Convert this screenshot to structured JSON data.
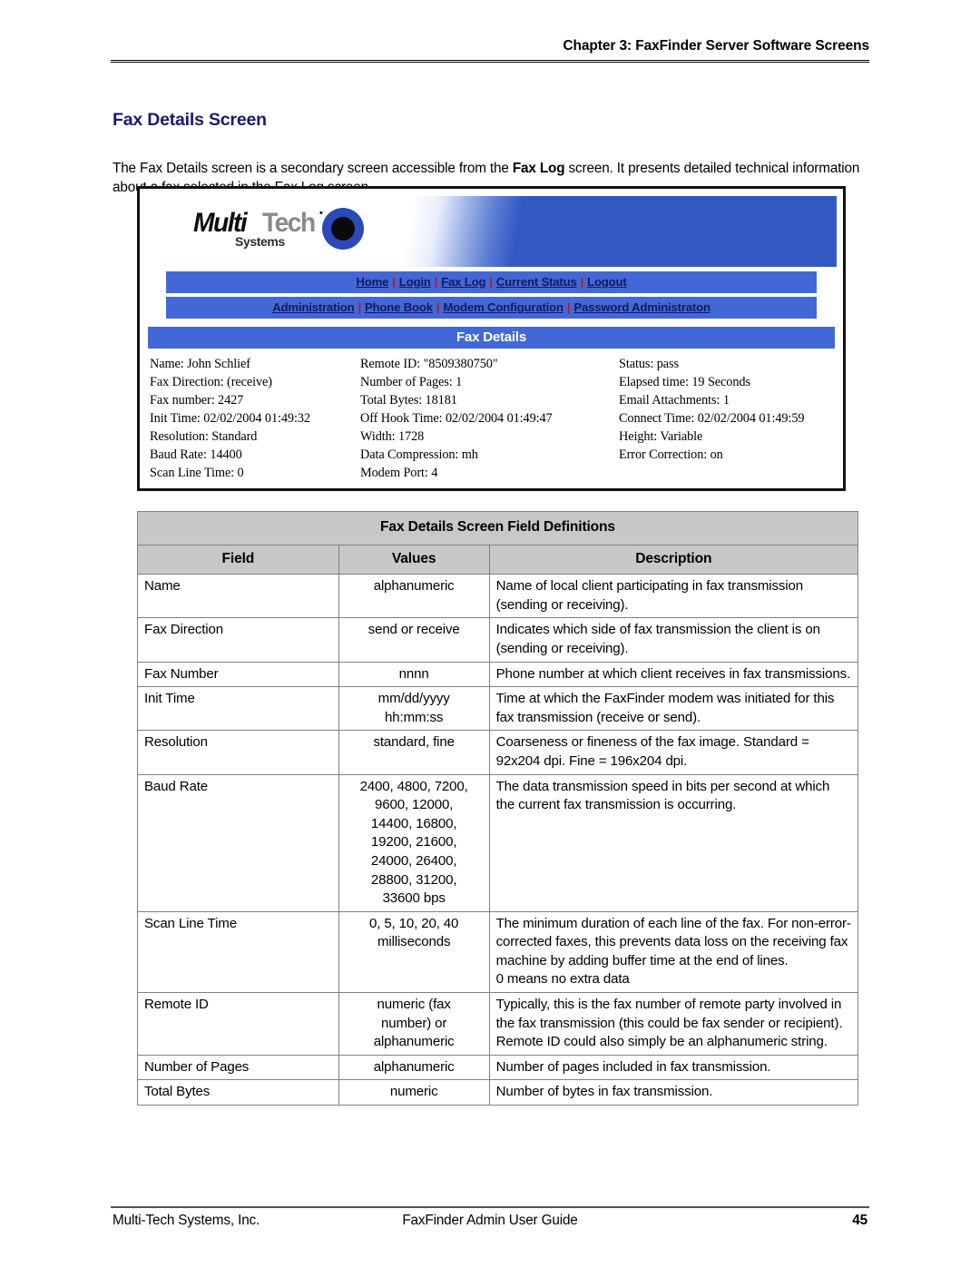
{
  "page": {
    "running_header": "Chapter 3: FaxFinder Server Software Screens",
    "section_title": "Fax Details Screen",
    "intro_part1": "The Fax Details screen is a secondary screen accessible from the ",
    "intro_bold": "Fax Log",
    "intro_part2": " screen.  It presents detailed technical information about a fax selected in the Fax Log screen."
  },
  "screenshot": {
    "logo": {
      "multi": "Multi",
      "tech": "Tech",
      "trademark": "•",
      "systems": "Systems"
    },
    "nav_primary": [
      {
        "label": "Home"
      },
      {
        "label": "Login"
      },
      {
        "label": "Fax Log"
      },
      {
        "label": "Current Status"
      },
      {
        "label": "Logout"
      }
    ],
    "nav_secondary": [
      {
        "label": "Administration"
      },
      {
        "label": "Phone Book"
      },
      {
        "label": "Modem Configuration"
      },
      {
        "label": "Password Administraton"
      }
    ],
    "nav_separator": "|",
    "panel_title": "Fax Details",
    "fields": [
      {
        "c1": "Name: John Schlief",
        "c2": "Remote ID: \"8509380750\"",
        "c3": "Status: pass"
      },
      {
        "c1": "Fax Direction: (receive)",
        "c2": "Number of Pages: 1",
        "c3": "Elapsed time: 19 Seconds"
      },
      {
        "c1": "Fax number: 2427",
        "c2": "Total Bytes: 18181",
        "c3": "Email Attachments: 1"
      },
      {
        "c1": "Init Time: 02/02/2004 01:49:32",
        "c2": "Off Hook Time: 02/02/2004 01:49:47",
        "c3": "Connect Time: 02/02/2004 01:49:59"
      },
      {
        "c1": "Resolution: Standard",
        "c2": "Width: 1728",
        "c3": "Height: Variable"
      },
      {
        "c1": "Baud Rate: 14400",
        "c2": "Data Compression: mh",
        "c3": "Error Correction: on"
      },
      {
        "c1": "Scan Line Time: 0",
        "c2": "Modem Port: 4",
        "c3": ""
      }
    ],
    "colors": {
      "nav_blue": "#4268D8",
      "banner_blue": "#3258C4",
      "link_navy": "#111A5E",
      "separator_red": "#CC1111"
    }
  },
  "definitions_table": {
    "caption": "Fax Details Screen Field Definitions",
    "headers": {
      "field": "Field",
      "values": "Values",
      "description": "Description"
    },
    "rows": [
      {
        "field": "Name",
        "values": "alphanumeric",
        "description": "Name of local client participating in fax transmission (sending or receiving)."
      },
      {
        "field": "Fax Direction",
        "values": "send or receive",
        "description": "Indicates which side of fax transmission the client is on (sending or receiving)."
      },
      {
        "field": "Fax Number",
        "values": "nnnn",
        "description": "Phone number at which client receives in fax transmissions."
      },
      {
        "field": "Init Time",
        "values": "mm/dd/yyyy\nhh:mm:ss",
        "description": "Time at which the FaxFinder modem was initiated for this fax transmission (receive or send)."
      },
      {
        "field": "Resolution",
        "values": "standard, fine",
        "description": "Coarseness or fineness of the fax image. Standard = 92x204 dpi.  Fine = 196x204 dpi."
      },
      {
        "field": "Baud Rate",
        "values": "2400, 4800, 7200,\n9600, 12000,\n14400, 16800,\n19200, 21600,\n24000, 26400,\n28800, 31200,\n33600 bps",
        "description": "The data transmission speed in bits per second at which the current fax transmission is occurring."
      },
      {
        "field": "Scan Line Time",
        "values": "0, 5, 10, 20, 40\nmilliseconds",
        "description": "The minimum duration of each line of the fax. For non-error-corrected faxes, this prevents data loss on the receiving fax machine by adding buffer time at the end of lines.\n0 means no extra data"
      },
      {
        "field": "Remote ID",
        "values": "numeric (fax\nnumber) or\nalphanumeric",
        "description": "Typically, this is the fax number of remote party involved in the fax transmission (this could be fax sender or recipient).  Remote ID could also simply be an alphanumeric string."
      },
      {
        "field": "Number of Pages",
        "values": "alphanumeric",
        "description": "Number of pages included in fax transmission."
      },
      {
        "field": "Total Bytes",
        "values": "numeric",
        "description": "Number of bytes in fax transmission."
      }
    ]
  },
  "footer": {
    "left": "Multi-Tech Systems, Inc.",
    "center": "FaxFinder Admin User Guide",
    "page_number": "45"
  }
}
